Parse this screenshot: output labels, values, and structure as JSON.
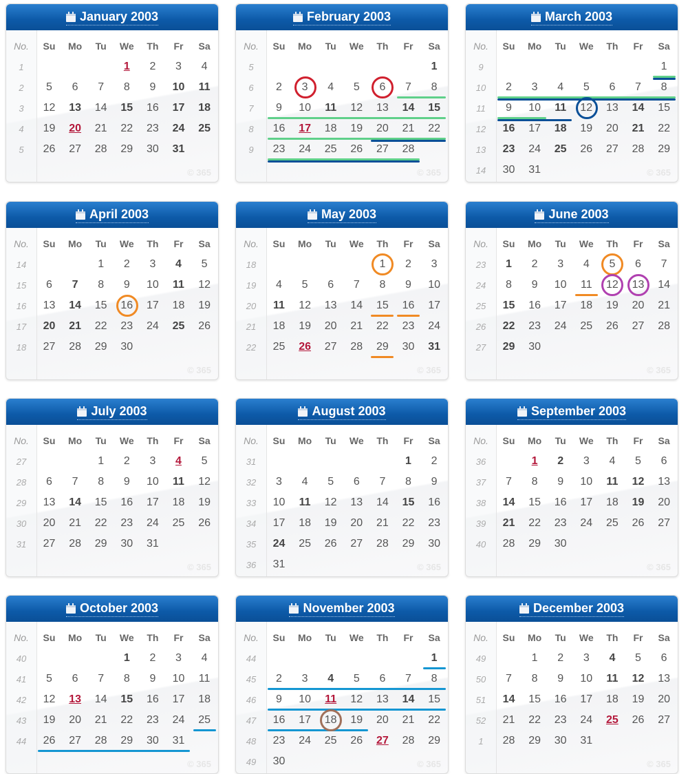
{
  "header_labels": {
    "week_no": "No.",
    "days": [
      "Su",
      "Mo",
      "Tu",
      "We",
      "Th",
      "Fr",
      "Sa"
    ],
    "watermark": "© 365"
  },
  "colors": {
    "header_blue": "#0d5aa8",
    "holiday_red": "#b3173a",
    "mark_red": "#d0202e",
    "mark_orange": "#f08a24",
    "mark_purple": "#b040b0",
    "mark_green": "#5fd08a",
    "mark_navy": "#0a4f97",
    "mark_cyan": "#1496d2",
    "mark_brown": "#a0705a"
  },
  "months": [
    {
      "title": "January 2003",
      "first_dow": 3,
      "days": 31,
      "weeks": [
        "1",
        "2",
        "3",
        "4",
        "5"
      ],
      "holidays": [
        1,
        20
      ],
      "bold": [
        10,
        11,
        13,
        15,
        17,
        18,
        24,
        25,
        31
      ]
    },
    {
      "title": "February 2003",
      "first_dow": 6,
      "days": 28,
      "weeks": [
        "5",
        "6",
        "7",
        "8",
        "9"
      ],
      "holidays": [
        17
      ],
      "bold": [
        1,
        11,
        14,
        15
      ]
    },
    {
      "title": "March 2003",
      "first_dow": 6,
      "days": 31,
      "weeks": [
        "9",
        "10",
        "11",
        "12",
        "13",
        "14"
      ],
      "holidays": [],
      "bold": [
        11,
        14,
        16,
        18,
        21,
        23,
        25
      ]
    },
    {
      "title": "April 2003",
      "first_dow": 2,
      "days": 30,
      "weeks": [
        "14",
        "15",
        "16",
        "17",
        "18"
      ],
      "holidays": [],
      "bold": [
        4,
        7,
        11,
        14,
        20,
        21,
        25
      ]
    },
    {
      "title": "May 2003",
      "first_dow": 4,
      "days": 31,
      "weeks": [
        "18",
        "19",
        "20",
        "21",
        "22"
      ],
      "holidays": [
        26
      ],
      "bold": [
        11,
        31
      ]
    },
    {
      "title": "June 2003",
      "first_dow": 0,
      "days": 30,
      "weeks": [
        "23",
        "24",
        "25",
        "26",
        "27"
      ],
      "holidays": [],
      "bold": [
        1,
        15,
        22,
        29
      ]
    },
    {
      "title": "July 2003",
      "first_dow": 2,
      "days": 31,
      "weeks": [
        "27",
        "28",
        "29",
        "30",
        "31"
      ],
      "holidays": [
        4
      ],
      "bold": [
        11,
        14
      ]
    },
    {
      "title": "August 2003",
      "first_dow": 5,
      "days": 31,
      "weeks": [
        "31",
        "32",
        "33",
        "34",
        "35",
        "36"
      ],
      "holidays": [],
      "bold": [
        1,
        11,
        15,
        24
      ]
    },
    {
      "title": "September 2003",
      "first_dow": 1,
      "days": 30,
      "weeks": [
        "36",
        "37",
        "38",
        "39",
        "40"
      ],
      "holidays": [
        1
      ],
      "bold": [
        2,
        11,
        12,
        14,
        19,
        21
      ]
    },
    {
      "title": "October 2003",
      "first_dow": 3,
      "days": 31,
      "weeks": [
        "40",
        "41",
        "42",
        "43",
        "44"
      ],
      "holidays": [
        13
      ],
      "bold": [
        1,
        15
      ]
    },
    {
      "title": "November 2003",
      "first_dow": 6,
      "days": 30,
      "weeks": [
        "44",
        "45",
        "46",
        "47",
        "48",
        "49"
      ],
      "holidays": [
        11,
        27
      ],
      "bold": [
        1,
        4,
        14
      ]
    },
    {
      "title": "December 2003",
      "first_dow": 1,
      "days": 31,
      "weeks": [
        "49",
        "50",
        "51",
        "52",
        "1"
      ],
      "holidays": [
        25
      ],
      "bold": [
        4,
        11,
        12,
        14
      ]
    }
  ],
  "annotations": [
    {
      "month": 1,
      "type": "circle",
      "days": [
        3,
        6
      ],
      "color": "mark_red"
    },
    {
      "month": 1,
      "type": "underline",
      "ranges": [
        [
          7,
          8
        ],
        [
          9,
          15
        ],
        [
          16,
          22
        ],
        [
          23,
          28
        ]
      ],
      "color": "mark_green"
    },
    {
      "month": 1,
      "type": "underline",
      "ranges": [
        [
          20,
          22
        ],
        [
          23,
          28
        ]
      ],
      "color": "mark_navy"
    },
    {
      "month": 2,
      "type": "underline",
      "ranges": [
        [
          1,
          1
        ],
        [
          2,
          8
        ],
        [
          9,
          10
        ]
      ],
      "color": "mark_green"
    },
    {
      "month": 2,
      "type": "underline",
      "ranges": [
        [
          1,
          1
        ],
        [
          2,
          8
        ],
        [
          9,
          11
        ]
      ],
      "color": "mark_navy"
    },
    {
      "month": 2,
      "type": "circle",
      "days": [
        12
      ],
      "color": "mark_navy"
    },
    {
      "month": 3,
      "type": "circle",
      "days": [
        16
      ],
      "color": "mark_orange"
    },
    {
      "month": 4,
      "type": "circle",
      "days": [
        1
      ],
      "color": "mark_orange"
    },
    {
      "month": 4,
      "type": "underline",
      "ranges": [
        [
          15,
          15
        ],
        [
          16,
          16
        ],
        [
          29,
          29
        ]
      ],
      "color": "mark_orange"
    },
    {
      "month": 5,
      "type": "circle",
      "days": [
        5
      ],
      "color": "mark_orange"
    },
    {
      "month": 5,
      "type": "underline",
      "ranges": [
        [
          11,
          11
        ]
      ],
      "color": "mark_orange"
    },
    {
      "month": 5,
      "type": "circle",
      "days": [
        12,
        13
      ],
      "color": "mark_purple"
    },
    {
      "month": 9,
      "type": "underline",
      "ranges": [
        [
          25,
          25
        ],
        [
          26,
          31
        ]
      ],
      "color": "mark_cyan"
    },
    {
      "month": 10,
      "type": "underline",
      "ranges": [
        [
          1,
          1
        ],
        [
          2,
          8
        ],
        [
          9,
          15
        ],
        [
          16,
          19
        ]
      ],
      "color": "mark_cyan"
    },
    {
      "month": 10,
      "type": "circle",
      "days": [
        18
      ],
      "color": "mark_brown"
    }
  ]
}
